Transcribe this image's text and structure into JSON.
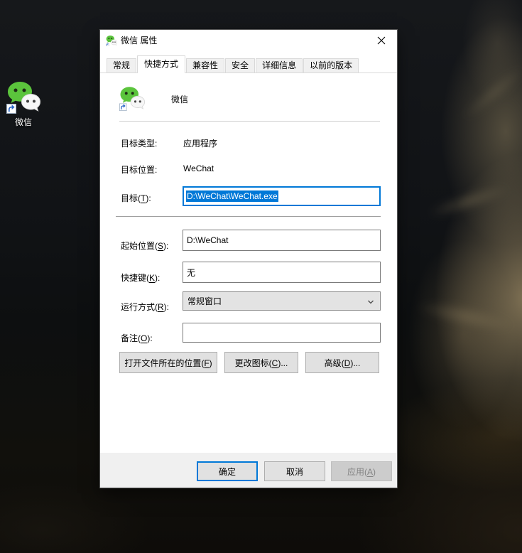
{
  "desktop": {
    "wechat_icon_label": "微信"
  },
  "window": {
    "title": "微信 属性",
    "active_tab": "快捷方式",
    "tabs": [
      {
        "label": "常规"
      },
      {
        "label": "快捷方式"
      },
      {
        "label": "兼容性"
      },
      {
        "label": "安全"
      },
      {
        "label": "详细信息"
      },
      {
        "label": "以前的版本"
      }
    ],
    "shortcut": {
      "app_name": "微信",
      "target_type_label": "目标类型:",
      "target_type_value": "应用程序",
      "target_location_label": "目标位置:",
      "target_location_value": "WeChat",
      "target_label": {
        "pre": "目标(",
        "key": "T",
        "suf": "):"
      },
      "target_value": "D:\\WeChat\\WeChat.exe",
      "target_text_selected": true,
      "start_in_label": {
        "pre": "起始位置(",
        "key": "S",
        "suf": "):"
      },
      "start_in_value": "D:\\WeChat",
      "hotkey_label": {
        "pre": "快捷键(",
        "key": "K",
        "suf": "):"
      },
      "hotkey_value": "无",
      "run_label": {
        "pre": "运行方式(",
        "key": "R",
        "suf": "):"
      },
      "run_value": "常规窗口",
      "comment_label": {
        "pre": "备注(",
        "key": "O",
        "suf": "):"
      },
      "comment_value": "",
      "buttons": {
        "open_location": {
          "pre": "打开文件所在的位置(",
          "key": "F",
          "suf": ")"
        },
        "change_icon": {
          "pre": "更改图标(",
          "key": "C",
          "suf": ")..."
        },
        "advanced": {
          "pre": "高级(",
          "key": "D",
          "suf": ")..."
        }
      }
    },
    "footer": {
      "ok": "确定",
      "cancel": "取消",
      "apply": {
        "pre": "应用(",
        "key": "A",
        "suf": ")"
      },
      "apply_enabled": false
    }
  },
  "colors": {
    "accent": "#0078d7",
    "selection": "#0078d7",
    "wechat_green": "#5bc43c",
    "dialog_bg": "#ffffff",
    "footer_bg": "#f0f0f0",
    "button_face": "#e1e1e1"
  }
}
